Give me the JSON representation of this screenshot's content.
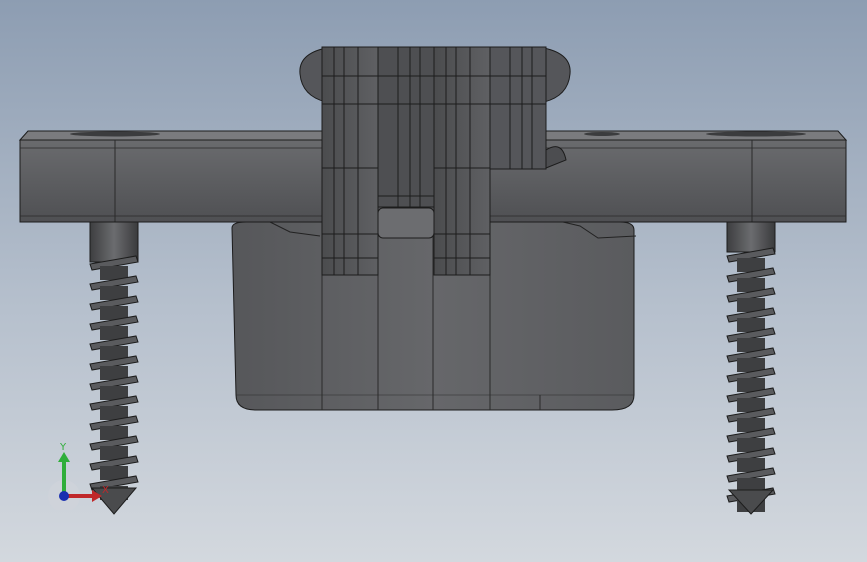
{
  "viewport": {
    "background_top": "#8d9db2",
    "background_bottom": "#d3d8de"
  },
  "model": {
    "part_color": "#5e5f61",
    "edge_color": "#1c1c1c",
    "components": [
      "hinge-plate",
      "knuckle-stack",
      "hinge-body",
      "left-screw",
      "right-screw"
    ]
  },
  "triad": {
    "y_label": "Y",
    "x_label": "X",
    "y_color": "#2fae3a",
    "x_color": "#c0282a",
    "z_color": "#1a2fb0"
  }
}
